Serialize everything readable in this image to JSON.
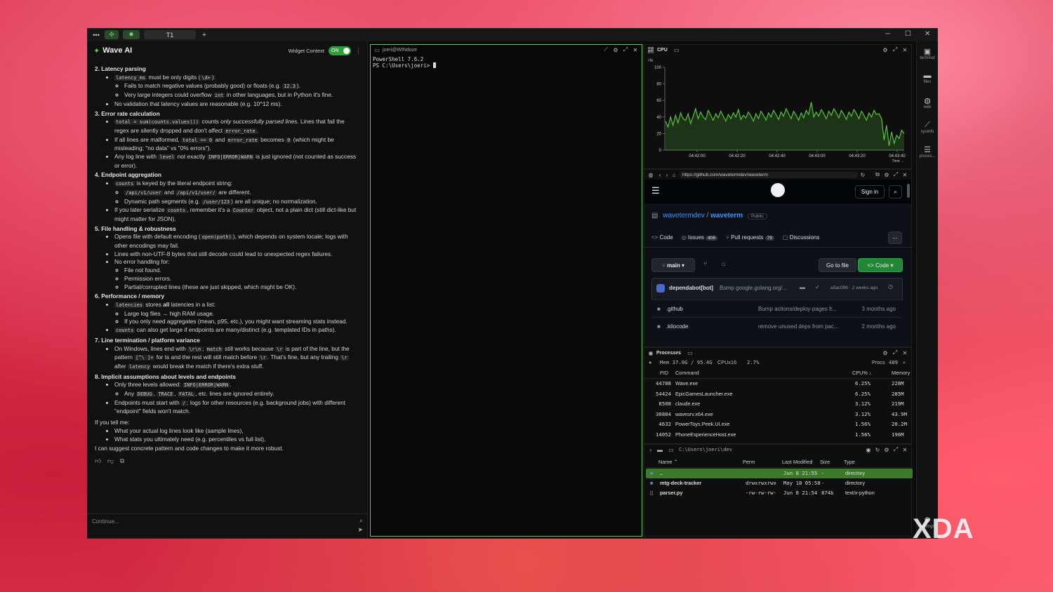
{
  "titlebar": {
    "dots": "•••",
    "tab1": "T1",
    "add": "+",
    "minimize": "─",
    "maximize": "☐",
    "close": "✕"
  },
  "ai": {
    "title": "Wave AI",
    "widget_context_label": "Widget Context",
    "toggle": "ON",
    "s2": "2. Latency parsing",
    "s2a": "latency_ms",
    "s2a2": " must be only digits (",
    "s2a3": "\\d+",
    "s2a4": "):",
    "s2b": "Fails to match negative values (probably good) or floats (e.g. ",
    "s2b2": "12.3",
    "s2b3": ").",
    "s2c": "Very large integers could overflow ",
    "s2c2": "int",
    "s2c3": " in other languages, but in Python it's fine.",
    "s2d": "No validation that latency values are reasonable (e.g. 10^12 ms).",
    "s3": "3. Error rate calculation",
    "s3a": "total = sum(counts.values())",
    "s3a2": " counts ",
    "s3a3": "only successfully parsed lines.",
    "s3a4": " Lines that fail the regex are silently dropped and don't affect ",
    "s3a5": "error_rate",
    "s3a6": ".",
    "s3b": "If all lines are malformed, ",
    "s3b2": "total == 0",
    "s3b3": " and ",
    "s3b4": "error_rate",
    "s3b5": " becomes ",
    "s3b6": "0",
    "s3b7": " (which might be misleading; \"no data\" vs \"0% errors\").",
    "s3c": "Any log line with ",
    "s3c2": "level",
    "s3c3": " not exactly ",
    "s3c4": "INFO|ERROR|WARN",
    "s3c5": " is just ignored (not counted as success or error).",
    "s4": "4. Endpoint aggregation",
    "s4a": "counts",
    "s4a2": " is keyed by the literal endpoint string:",
    "s4b": "/api/v1/user",
    "s4b2": " and ",
    "s4b3": "/api/v1/user/",
    "s4b4": " are different.",
    "s4c": "Dynamic path segments (e.g. ",
    "s4c2": "/user/123",
    "s4c3": ") are all unique; no normalization.",
    "s4d": "If you later serialize ",
    "s4d2": "counts",
    "s4d3": ", remember it's a ",
    "s4d4": "Counter",
    "s4d5": " object, not a plain dict (still dict-like but might matter for JSON).",
    "s5": "5. File handling & robustness",
    "s5a": "Opens file with default encoding (",
    "s5a2": "open(path)",
    "s5a3": "), which depends on system locale; logs with other encodings may fail.",
    "s5b": "Lines with non-UTF-8 bytes that still decode could lead to unexpected regex failures.",
    "s5c": "No error handling for:",
    "s5d": "File not found.",
    "s5e": "Permission errors.",
    "s5f": "Partial/corrupted lines (these are just skipped, which might be OK).",
    "s6": "6. Performance / memory",
    "s6a": "latencies",
    "s6a2": " stores ",
    "s6a3": "all",
    "s6a4": " latencies in a list:",
    "s6b": "Large log files → high RAM usage.",
    "s6c": "If you only need aggregates (mean, p95, etc.), you might want streaming stats instead.",
    "s6d": "counts",
    "s6d2": " can also get large if endpoints are many/distinct (e.g. templated IDs in paths).",
    "s7": "7. Line termination / platform variance",
    "s7a": "On Windows, lines end with ",
    "s7a2": "\\r\\n",
    "s7a3": "; ",
    "s7a4": "match",
    "s7a5": " still works because ",
    "s7a6": "\\r",
    "s7a7": " is part of the line, but the pattern ",
    "s7a8": "[^\\ ]+",
    "s7a9": " for ts and the rest will still match before ",
    "s7a10": "\\r",
    "s7a11": ". That's fine, but any trailing ",
    "s7a12": "\\r",
    "s7a13": " after ",
    "s7a14": "latency",
    "s7a15": " would break the match if there's extra stuff.",
    "s8": "8. Implicit assumptions about levels and endpoints",
    "s8a": "Only three levels allowed: ",
    "s8a2": "INFO|ERROR|WARN",
    "s8a3": ".",
    "s8b": "Any ",
    "s8b2": "DEBUG",
    "s8b3": ", ",
    "s8b4": "TRACE",
    "s8b5": ", ",
    "s8b6": "FATAL",
    "s8b7": ", etc. lines are ignored entirely.",
    "s8c": "Endpoints must start with ",
    "s8c2": "/",
    "s8c3": "; logs for other resources (e.g. background jobs) with different \"endpoint\" fields won't match.",
    "tell": "If you tell me:",
    "tell1": "What your actual log lines look like (sample lines),",
    "tell2": "What stats you ultimately need (e.g. percentiles vs full list),",
    "suggest": "I can suggest concrete pattern and code changes to make it more robust.",
    "input_placeholder": "Continue..."
  },
  "terminal": {
    "title": "joeri@WINdoze",
    "line1": "PowerShell 7.6.2",
    "line2": "PS C:\\Users\\joeri> "
  },
  "cpu": {
    "title": "CPU",
    "unit": "↑%",
    "y_ticks": [
      "100",
      "80",
      "60",
      "40",
      "20",
      "0"
    ],
    "x_ticks": [
      "04:42:00",
      "04:42:20",
      "04:42:40",
      "04:43:00",
      "04:43:20",
      "04:43:40"
    ],
    "x_label": "Time →",
    "line_color": "#58c142",
    "values": [
      35,
      28,
      40,
      30,
      42,
      33,
      45,
      38,
      36,
      44,
      32,
      41,
      50,
      38,
      46,
      40,
      37,
      48,
      42,
      36,
      44,
      39,
      47,
      41,
      35,
      43,
      38,
      45,
      40,
      49,
      37,
      42,
      39,
      46,
      41,
      35,
      44,
      38,
      47,
      42,
      36,
      45,
      40,
      48,
      43,
      37,
      46,
      41,
      50,
      44,
      38,
      47,
      42,
      36,
      45,
      39,
      48,
      43,
      58,
      40,
      46,
      41,
      49,
      44,
      38,
      47,
      42,
      50,
      45,
      39,
      48,
      43,
      37,
      46,
      41,
      49,
      44,
      38,
      47,
      42,
      36,
      45,
      40,
      48,
      43,
      44,
      38,
      12,
      30,
      5,
      22,
      8,
      18,
      14,
      24,
      20
    ]
  },
  "browser": {
    "url": "https://github.com/wavetermdev/waveterm",
    "sign_in": "Sign in",
    "owner": "wavetermdev",
    "slash": "/",
    "repo": "waveterm",
    "visibility": "Public",
    "tabs": [
      {
        "label": "Code",
        "count": ""
      },
      {
        "label": "Issues",
        "count": "408"
      },
      {
        "label": "Pull requests",
        "count": "79"
      },
      {
        "label": "Discussions",
        "count": ""
      }
    ],
    "branch": "main",
    "goto_file": "Go to file",
    "code_btn": "Code",
    "commit_author": "dependabot[bot]",
    "commit_msg": "Bump google.golang.org/...",
    "commit_hash": "a5ac096 · 2 weeks ago",
    "files": [
      {
        "name": ".github",
        "msg": "Bump actions/deploy-pages fr...",
        "time": "3 months ago"
      },
      {
        "name": ".kilocode",
        "msg": "remove unused deps from pac...",
        "time": "2 months ago"
      }
    ]
  },
  "processes": {
    "title": "Processes",
    "mem": "Mem 37.0G / 95.4G",
    "cpu": "CPUx16",
    "cpu_pct": "2.7%",
    "procs_label": "Procs",
    "procs_count": "489",
    "headers": {
      "pid": "PID",
      "command": "Command",
      "cpu": "CPU% ↓",
      "mem": "Memory"
    },
    "rows": [
      {
        "pid": "44708",
        "cmd": "Wave.exe",
        "cpu": "6.25%",
        "mem": "228M"
      },
      {
        "pid": "54424",
        "cmd": "EpicGamesLauncher.exe",
        "cpu": "6.25%",
        "mem": "285M"
      },
      {
        "pid": "8508",
        "cmd": "claude.exe",
        "cpu": "3.12%",
        "mem": "219M"
      },
      {
        "pid": "30884",
        "cmd": "wavesrv.x64.exe",
        "cpu": "3.12%",
        "mem": "43.9M"
      },
      {
        "pid": "4632",
        "cmd": "PowerToys.Peek.UI.exe",
        "cpu": "1.56%",
        "mem": "20.2M"
      },
      {
        "pid": "14052",
        "cmd": "PhoneExperienceHost.exe",
        "cpu": "1.56%",
        "mem": "196M"
      }
    ]
  },
  "files": {
    "path": "C:\\Users\\joeri\\dev",
    "headers": {
      "name": "Name ⌃",
      "perm": "Perm",
      "modified": "Last Modified",
      "size": "Size",
      "type": "Type"
    },
    "rows": [
      {
        "name": "..",
        "perm": "",
        "modified": "Jun 8 21:55",
        "size": "-",
        "type": "directory"
      },
      {
        "name": "mtg-deck-tracker",
        "perm": "drwxrwxrwx",
        "modified": "May 18 05:58",
        "size": "-",
        "type": "directory"
      },
      {
        "name": "parser.py",
        "perm": "-rw-rw-rw-",
        "modified": "Jun 8 21:54",
        "size": "874b",
        "type": "text/x-python"
      }
    ]
  },
  "sidebar": [
    "terminal",
    "files",
    "web",
    "sysinfo",
    "proces..."
  ],
  "sidebar_bottom": "settings",
  "watermark": "XDA"
}
